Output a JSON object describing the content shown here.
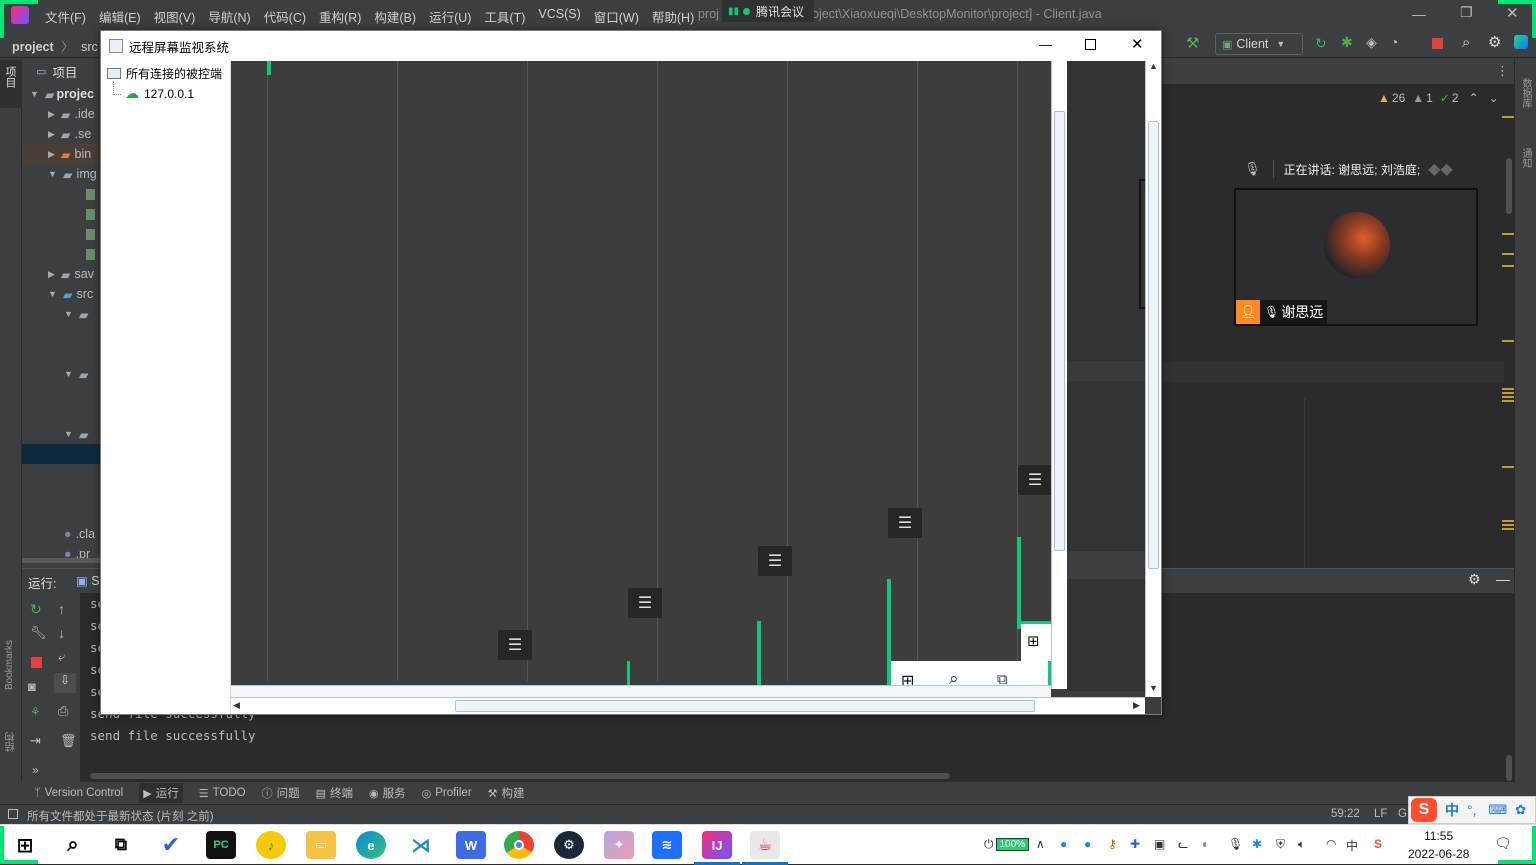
{
  "ide": {
    "menu": [
      "文件(F)",
      "编辑(E)",
      "视图(V)",
      "导航(N)",
      "代码(C)",
      "重构(R)",
      "构建(B)",
      "运行(U)",
      "工具(T)",
      "VCS(S)",
      "窗口(W)",
      "帮助(H)"
    ],
    "title_prefix": "proj",
    "title_suffix": "oject\\Xiaoxueqi\\DesktopMonitor\\project] - Client.java",
    "breadcrumb": [
      "project",
      "src"
    ],
    "run_config": "Client",
    "project_tab": "项目",
    "tree": [
      {
        "label": "projec",
        "bold": true
      },
      {
        "label": ".ide"
      },
      {
        "label": ".se"
      },
      {
        "label": "bin"
      },
      {
        "label": "img"
      },
      {
        "label": "sav"
      },
      {
        "label": "src"
      },
      {
        "label": ".cla"
      },
      {
        "label": ".pr"
      }
    ],
    "inspection": {
      "warnings": "26",
      "weak_warnings": "1",
      "typos": "2"
    },
    "left_stripe_labels": [
      "项目",
      "Bookmarks",
      "结构"
    ],
    "right_stripe_labels": [
      "数据库",
      "通知"
    ],
    "run": {
      "label": "运行:",
      "tab_fragment": "S",
      "console": [
        "se",
        "se",
        "se",
        "se",
        "se",
        "send file successfully",
        "send file successfully"
      ]
    },
    "tool_tabs": [
      "Version Control",
      "运行",
      "TODO",
      "问题",
      "终端",
      "服务",
      "Profiler",
      "构建"
    ],
    "status": {
      "message": "所有文件都处于最新状态 (片刻 之前)",
      "position": "59:22",
      "line_sep": "LF",
      "encoding_fragment": "G"
    }
  },
  "meeting": {
    "app_name": "腾讯会议",
    "speaking": "正在讲话: 谢思远; 刘浩庭;",
    "participant": "谢思远"
  },
  "swing": {
    "title": "远程屏幕监视系统",
    "tree_root": "所有连接的被控端",
    "tree_child": "127.0.0.1"
  },
  "ime": {
    "lang": "中"
  },
  "taskbar": {
    "battery": "100%",
    "time": "11:55",
    "date": "2022-06-28"
  }
}
